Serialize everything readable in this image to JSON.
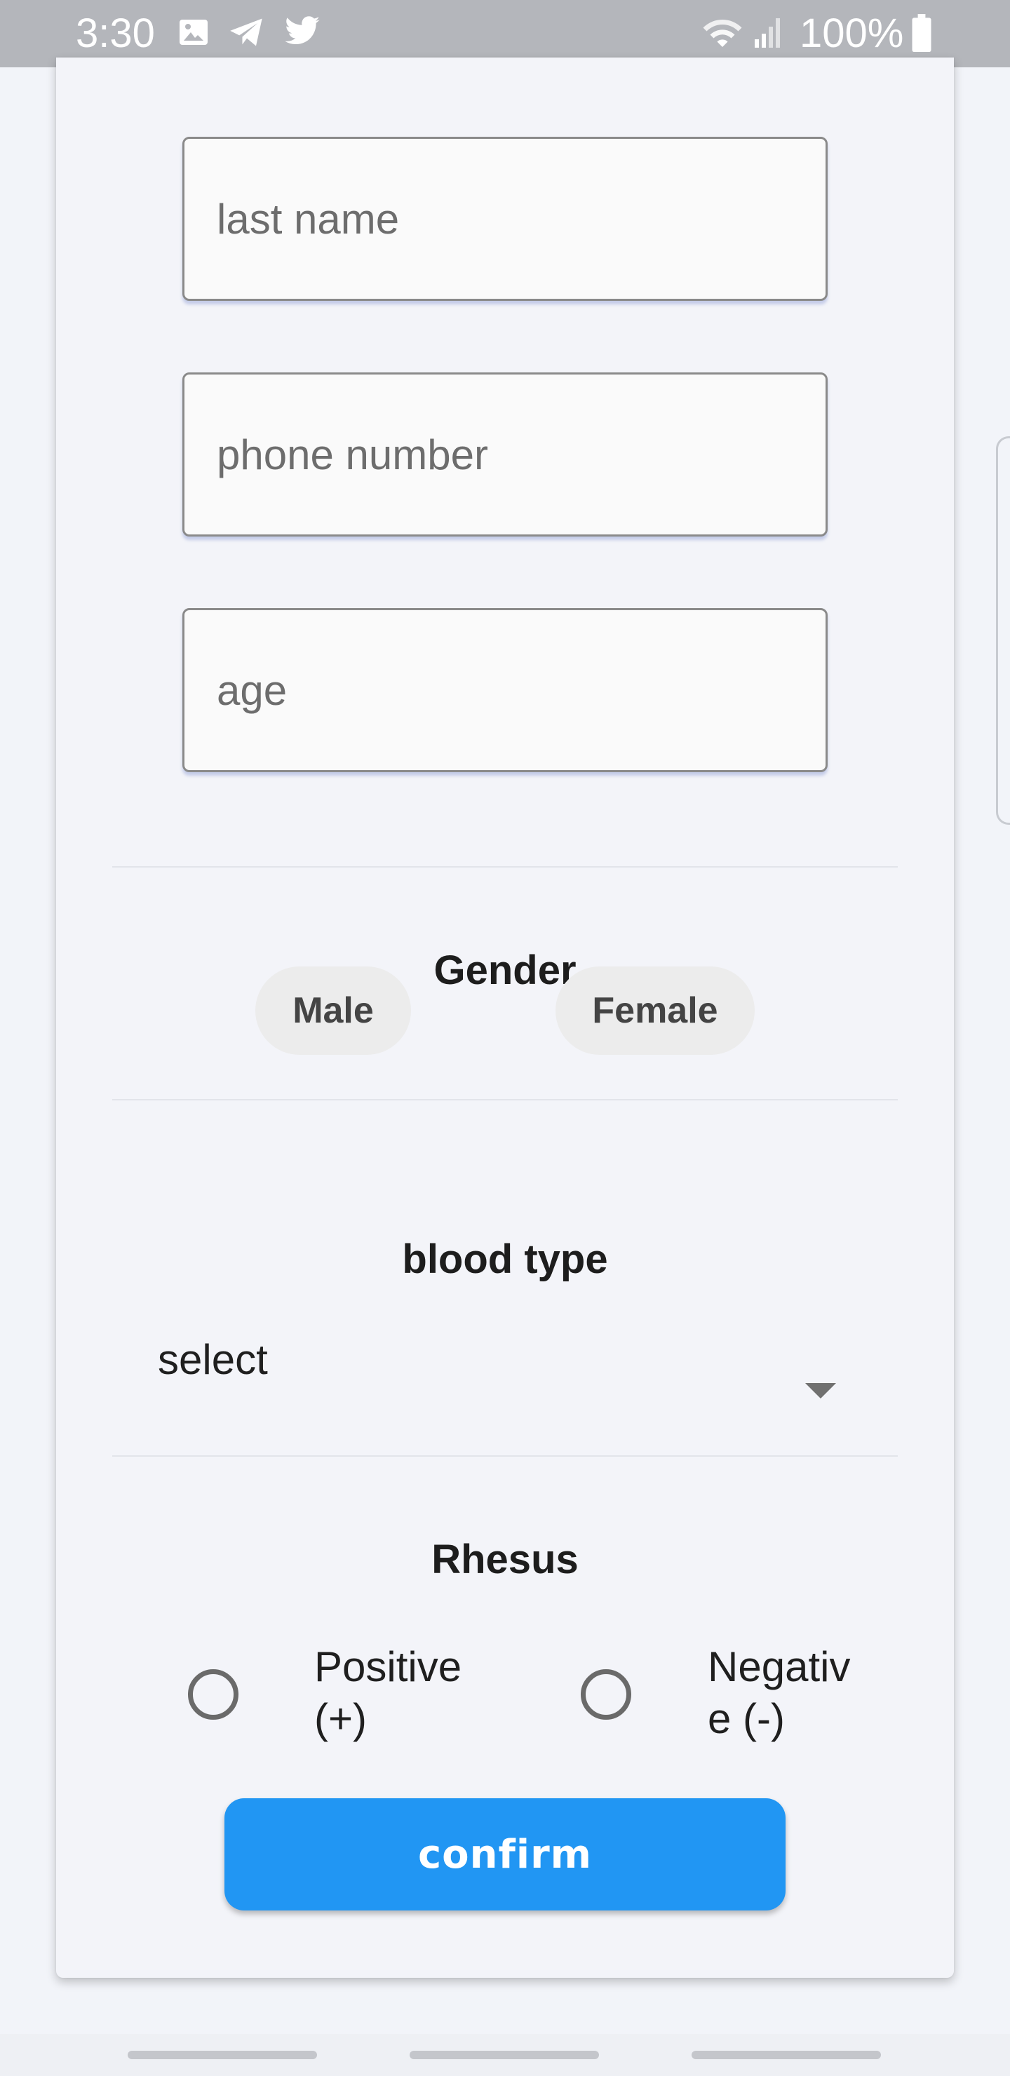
{
  "status_bar": {
    "time": "3:30",
    "battery": "100%",
    "icons": [
      "gallery-icon",
      "telegram-icon",
      "twitter-icon",
      "wifi-icon",
      "signal-icon",
      "battery-icon"
    ]
  },
  "form": {
    "last_name_placeholder": "last name",
    "phone_placeholder": "phone number",
    "age_placeholder": "age",
    "gender": {
      "title": "Gender",
      "options": [
        "Male",
        "Female"
      ]
    },
    "blood_type": {
      "title": "blood type",
      "selected": "select"
    },
    "rhesus": {
      "title": "Rhesus",
      "options": [
        "Positive (+)",
        "Negative (-)"
      ]
    },
    "confirm_label": "confirm"
  },
  "colors": {
    "accent": "#2196f3",
    "status_bar": "#b4b6bb",
    "background": "#f2f4f9"
  }
}
